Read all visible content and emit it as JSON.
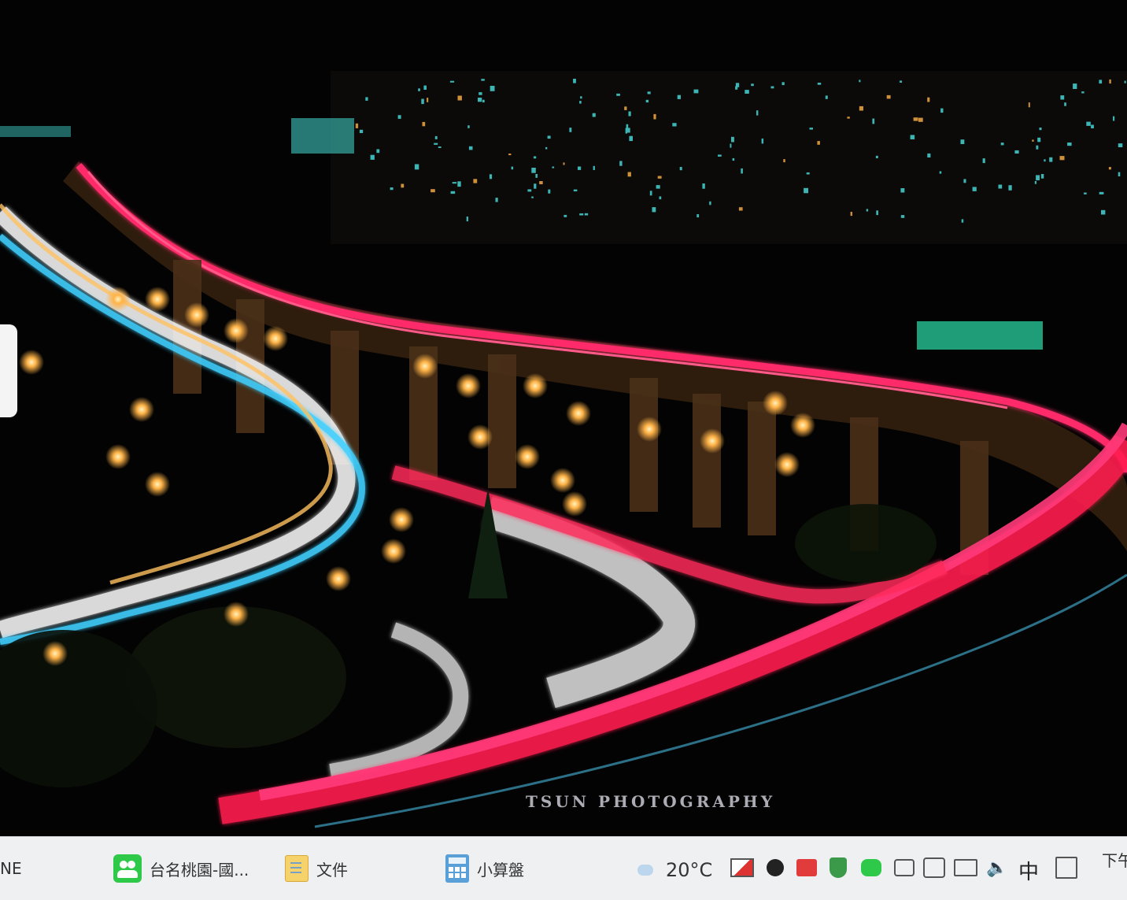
{
  "wallpaper": {
    "watermark": "TSUN PHOTOGRAPHY",
    "colors": {
      "light_trail_red": "#ff2a6a",
      "light_trail_white": "#ffffff",
      "light_trail_cyan": "#3fd0ff",
      "street_lamp": "#ffb347",
      "city_light": "#49e0e0"
    }
  },
  "taskbar": {
    "apps": [
      {
        "label": "NE",
        "icon": "line-app-icon"
      },
      {
        "label": "台名桃園-國...",
        "icon": "contacts-icon"
      },
      {
        "label": "文件",
        "icon": "folder-document-icon"
      },
      {
        "label": "小算盤",
        "icon": "calculator-icon"
      }
    ],
    "weather": {
      "temperature": "20°C",
      "icon": "cloud-icon"
    },
    "tray_icons": [
      "photo-icon",
      "bird-icon",
      "red-app-icon",
      "shield-icon",
      "chat-icon",
      "camera-icon",
      "sync-icon",
      "network-icon",
      "volume-icon",
      "notification-icon"
    ],
    "volume_glyph": "🔈",
    "ime": "中",
    "clock": "下午"
  }
}
